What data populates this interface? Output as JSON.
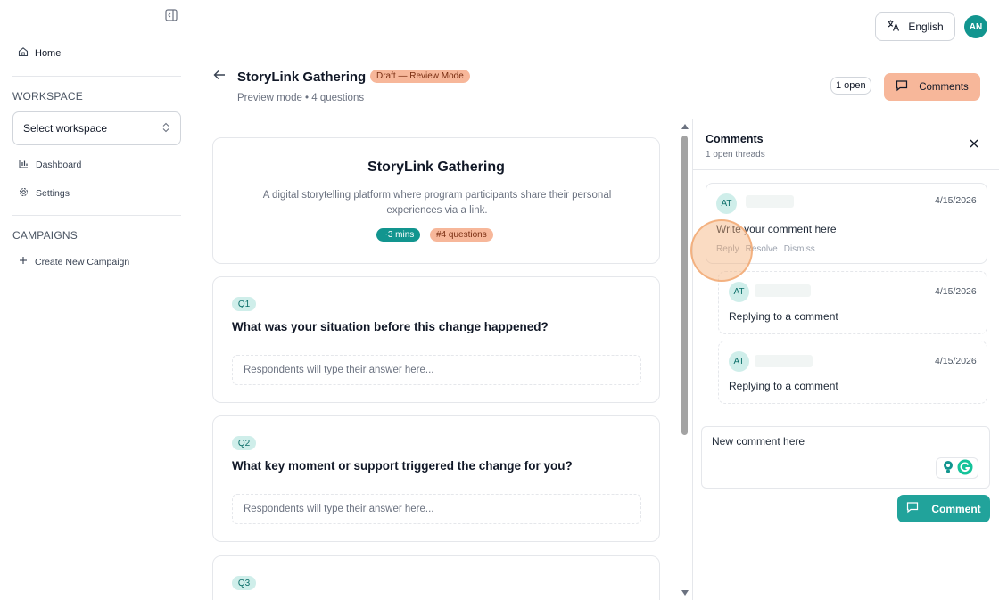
{
  "sidebar": {
    "home_label": "Home",
    "workspace_heading": "WORKSPACE",
    "workspace_select": "Select workspace",
    "items": [
      {
        "label": "Dashboard"
      },
      {
        "label": "Settings"
      }
    ],
    "campaigns_heading": "CAMPAIGNS",
    "create_campaign": "Create New Campaign"
  },
  "topbar": {
    "language": "English",
    "avatar_initials": "AN"
  },
  "header": {
    "title": "StoryLink Gathering",
    "badge": "Draft — Review Mode",
    "subtitle": "Preview mode • 4 questions",
    "open_count": "1 open",
    "comments_label": "Comments"
  },
  "preview": {
    "title": "StoryLink Gathering",
    "description": "A digital storytelling platform where program participants share their personal experiences via a link.",
    "duration": "~3 mins",
    "question_count": "#4 questions",
    "questions": [
      {
        "badge": "Q1",
        "text": "What was your situation before this change happened?",
        "placeholder": "Respondents will type their answer here..."
      },
      {
        "badge": "Q2",
        "text": "What key moment or support triggered the change for you?",
        "placeholder": "Respondents will type their answer here..."
      },
      {
        "badge": "Q3"
      }
    ]
  },
  "comments_panel": {
    "title": "Comments",
    "subtitle": "1 open threads",
    "thread": {
      "initials": "AT",
      "date": "4/15/2026",
      "body": "Write your comment here",
      "actions": [
        "Reply",
        "Resolve",
        "Dismiss"
      ]
    },
    "replies": [
      {
        "initials": "AT",
        "date": "4/15/2026",
        "body": "Replying to a comment"
      },
      {
        "initials": "AT",
        "date": "4/15/2026",
        "body": "Replying to a comment"
      }
    ],
    "new_comment_value": "New comment here",
    "submit_label": "Comment"
  },
  "colors": {
    "accent_teal": "#12958f",
    "accent_peach": "#f7b79a"
  }
}
